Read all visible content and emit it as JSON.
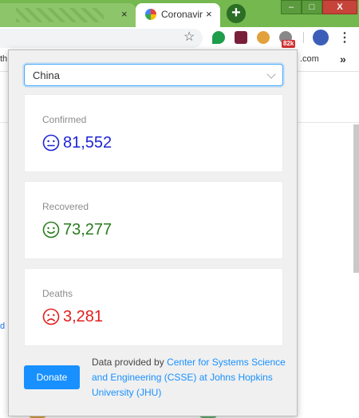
{
  "browser": {
    "active_tab_title": "Coronavirus",
    "tab_close_glyph": "×",
    "new_tab_glyph": "+",
    "window_controls": {
      "minimize": "–",
      "maximize": "□",
      "close": "X"
    },
    "extension_badge": "82k",
    "menu_glyph": "⋮",
    "bookmarks": {
      "left_partial": "th",
      "right_partial": ".com",
      "overflow": "»"
    },
    "page_link_partial": "d"
  },
  "popup": {
    "country_select": {
      "value": "China"
    },
    "stats": [
      {
        "label": "Confirmed",
        "value": "81,552",
        "mood": "neutral",
        "color": "#1d24d6"
      },
      {
        "label": "Recovered",
        "value": "73,277",
        "mood": "happy",
        "color": "#2a7d1f"
      },
      {
        "label": "Deaths",
        "value": "3,281",
        "mood": "sad",
        "color": "#e31e1e"
      }
    ],
    "donate_label": "Donate",
    "credit": {
      "prefix": "Data provided by ",
      "link_text": "Center for Systems Science and Engineering (CSSE) at Johns Hopkins University (JHU)"
    }
  }
}
